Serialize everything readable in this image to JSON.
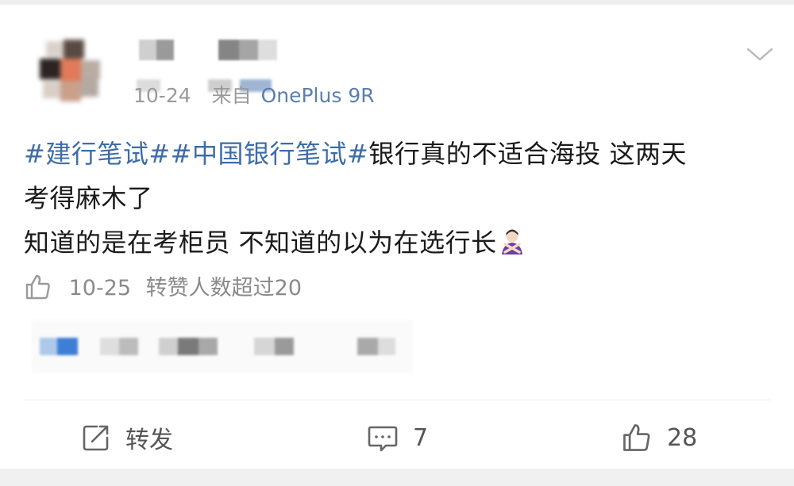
{
  "post": {
    "username_redacted": true,
    "date": "10-24",
    "source_prefix": "来自",
    "device": "OnePlus 9R",
    "content": {
      "tag1": "#建行笔试#",
      "tag2": "#中国银行笔试#",
      "line1_text": "银行真的不适合海投 这两天",
      "line2_text": "考得麻木了",
      "line3_text": "知道的是在考柜员 不知道的以为在选行长"
    },
    "emoji": "person-gesturing-no-emoji",
    "likes_date": "10-25",
    "likes_text": "转赞人数超过20"
  },
  "actions": {
    "repost_label": "转发",
    "comment_count": "7",
    "like_count": "28"
  },
  "icons": {
    "chevron": "chevron-down-icon",
    "repost": "repost-icon",
    "comment": "comment-icon",
    "like": "thumbs-up-icon"
  },
  "colors": {
    "link": "#3d6ca6",
    "device": "#5b7fae",
    "meta": "#9a9a9a",
    "text": "#1a1a1a",
    "action": "#555555"
  }
}
